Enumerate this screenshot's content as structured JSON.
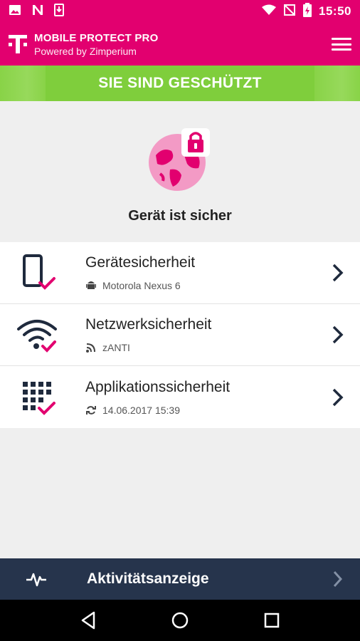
{
  "status_bar": {
    "time": "15:50",
    "icons": [
      "gallery-icon",
      "n-notification-icon",
      "download-icon",
      "wifi-icon",
      "no-sim-icon",
      "battery-charging-icon"
    ]
  },
  "app_bar": {
    "title": "MOBILE PROTECT PRO",
    "subtitle": "Powered by Zimperium",
    "logo": "telekom-t-logo",
    "menu_icon": "hamburger-menu-icon"
  },
  "banner": {
    "text": "SIE SIND GESCHÜTZT"
  },
  "hero": {
    "icon": "globe-lock-icon",
    "status": "Gerät ist sicher"
  },
  "items": [
    {
      "label": "Gerätesicherheit",
      "sub_icon": "android-icon",
      "sub_text": "Motorola Nexus 6",
      "icon": "device-check-icon"
    },
    {
      "label": "Netzwerksicherheit",
      "sub_icon": "wifi-signal-icon",
      "sub_text": "zANTI",
      "icon": "wifi-check-icon"
    },
    {
      "label": "Applikationssicherheit",
      "sub_icon": "sync-icon",
      "sub_text": "14.06.2017 15:39",
      "icon": "apps-check-icon"
    }
  ],
  "bottom_bar": {
    "label": "Aktivitätsanzeige",
    "icon": "pulse-icon"
  },
  "nav": {
    "back": "back-icon",
    "home": "home-icon",
    "recents": "recents-icon"
  },
  "colors": {
    "brand": "#e2006f",
    "success": "#7fce3c",
    "dark": "#26344c",
    "check": "#e2006f"
  }
}
